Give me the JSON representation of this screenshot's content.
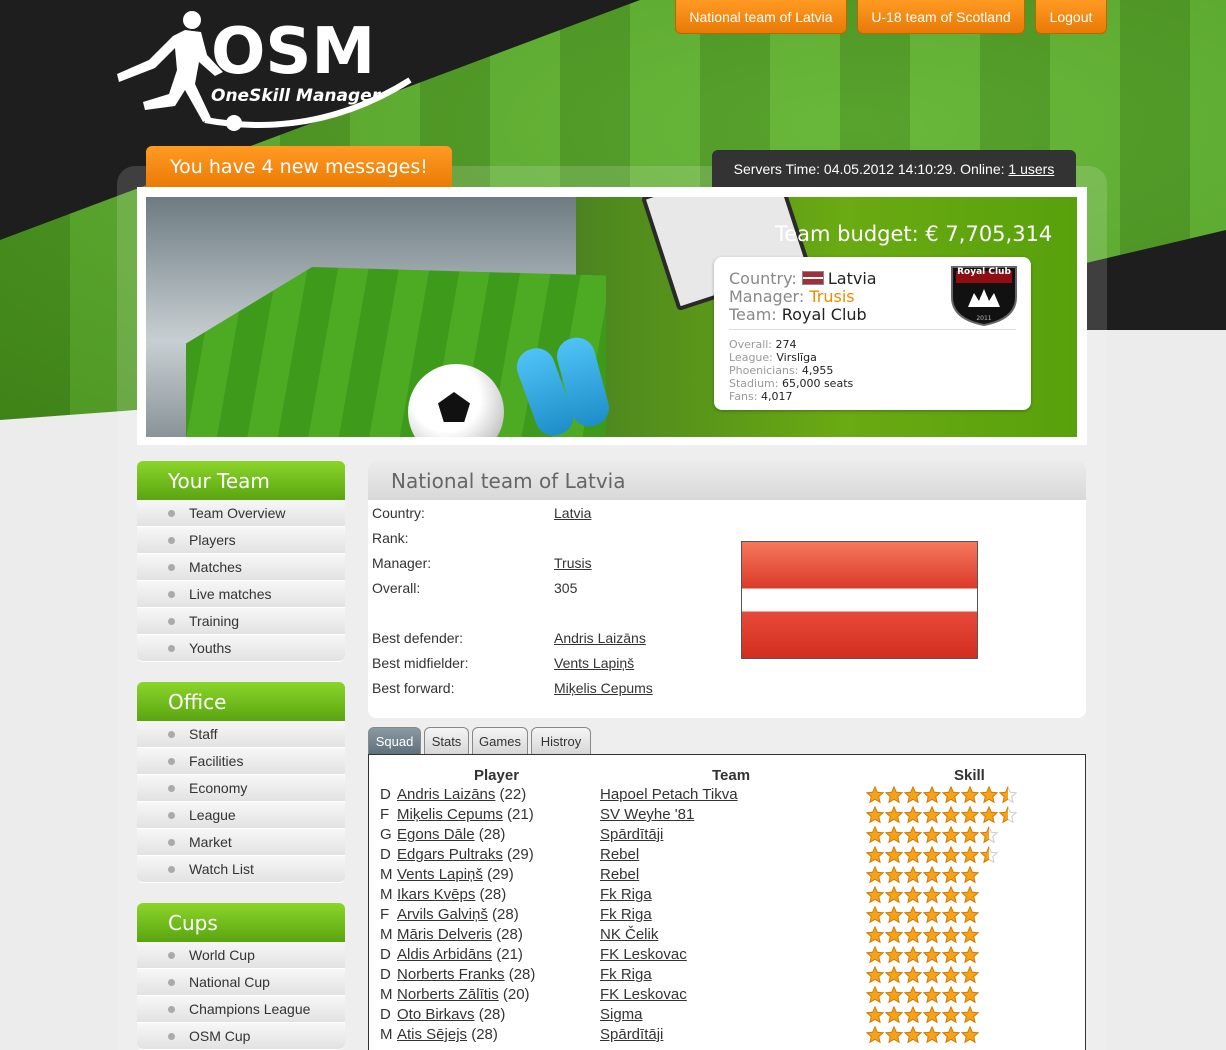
{
  "header": {
    "logo_title": "OSM",
    "logo_subtitle": "OneSkill Manager",
    "buttons": [
      {
        "label": "National team of Latvia"
      },
      {
        "label": "U-18 team of Scotland"
      },
      {
        "label": "Logout"
      }
    ],
    "messages": "You have 4 new messages!",
    "server_prefix": "Servers Time: 04.05.2012 14:10:29. Online: ",
    "online_link": "1 users"
  },
  "banner": {
    "budget": "Team budget: € 7,705,314",
    "country_label": "Country:",
    "country": "Latvia",
    "manager_label": "Manager:",
    "manager": "Trusis",
    "team_label": "Team:",
    "team": "Royal Club",
    "crest_text": "Royal Club",
    "crest_year": "2011",
    "overall_label": "Overall:",
    "overall": "274",
    "league_label": "League:",
    "league": "Virslīga",
    "phoenicians_label": "Phoenicians:",
    "phoenicians": "4,955",
    "stadium_label": "Stadium:",
    "stadium": "65,000 seats",
    "fans_label": "Fans:",
    "fans": "4,017"
  },
  "sidebar": {
    "your_team": {
      "title": "Your Team",
      "items": [
        "Team Overview",
        "Players",
        "Matches",
        "Live matches",
        "Training",
        "Youths"
      ]
    },
    "office": {
      "title": "Office",
      "items": [
        "Staff",
        "Facilities",
        "Economy",
        "League",
        "Market",
        "Watch List"
      ]
    },
    "cups": {
      "title": "Cups",
      "items": [
        "World Cup",
        "National Cup",
        "Champions League",
        "OSM Cup"
      ]
    }
  },
  "national": {
    "title": "National team of Latvia",
    "country_label": "Country:",
    "country": "Latvia",
    "rank_label": "Rank:",
    "manager_label": "Manager:",
    "manager": "Trusis",
    "overall_label": "Overall:",
    "overall": "305",
    "best_defender_label": "Best defender:",
    "best_defender": "Andris Laizāns",
    "best_midfielder_label": "Best midfielder:",
    "best_midfielder": "Vents Lapiņš",
    "best_forward_label": "Best forward:",
    "best_forward": "Miķelis Cepums"
  },
  "tabs": [
    "Squad",
    "Stats",
    "Games",
    "Histroy"
  ],
  "squad": {
    "headers": {
      "player": "Player",
      "team": "Team",
      "skill": "Skill"
    },
    "rows": [
      {
        "pos": "D",
        "name": "Andris Laizāns",
        "age": "(22)",
        "team": "Hapoel Petach Tikva",
        "stars": 7.5
      },
      {
        "pos": "F",
        "name": "Miķelis Cepums",
        "age": "(21)",
        "team": "SV Weyhe '81",
        "stars": 7.5
      },
      {
        "pos": "G",
        "name": "Egons Dāle",
        "age": "(28)",
        "team": "Spārdītāji",
        "stars": 6.5
      },
      {
        "pos": "D",
        "name": "Edgars Pultraks",
        "age": "(29)",
        "team": "Rebel",
        "stars": 6.5
      },
      {
        "pos": "M",
        "name": "Vents Lapiņš",
        "age": "(29)",
        "team": "Rebel",
        "stars": 6
      },
      {
        "pos": "M",
        "name": "Ikars Kvēps",
        "age": "(28)",
        "team": "Fk Riga",
        "stars": 6
      },
      {
        "pos": "F",
        "name": "Arvils Galviņš",
        "age": "(28)",
        "team": "Fk Riga",
        "stars": 6
      },
      {
        "pos": "M",
        "name": "Māris Delveris",
        "age": "(28)",
        "team": "NK Čelik",
        "stars": 6
      },
      {
        "pos": "D",
        "name": "Aldis Arbidāns",
        "age": "(21)",
        "team": "FK Leskovac",
        "stars": 6
      },
      {
        "pos": "D",
        "name": "Norberts Franks",
        "age": "(28)",
        "team": "Fk Riga",
        "stars": 6
      },
      {
        "pos": "M",
        "name": "Norberts Zālītis",
        "age": "(20)",
        "team": "FK Leskovac",
        "stars": 6
      },
      {
        "pos": "D",
        "name": "Oto Birkavs",
        "age": "(28)",
        "team": "Sigma",
        "stars": 6
      },
      {
        "pos": "M",
        "name": "Atis Sējejs",
        "age": "(28)",
        "team": "Spārdītāji",
        "stars": 6
      }
    ]
  },
  "colors": {
    "accent": "#f28a0c",
    "green": "#6cbf1a"
  }
}
